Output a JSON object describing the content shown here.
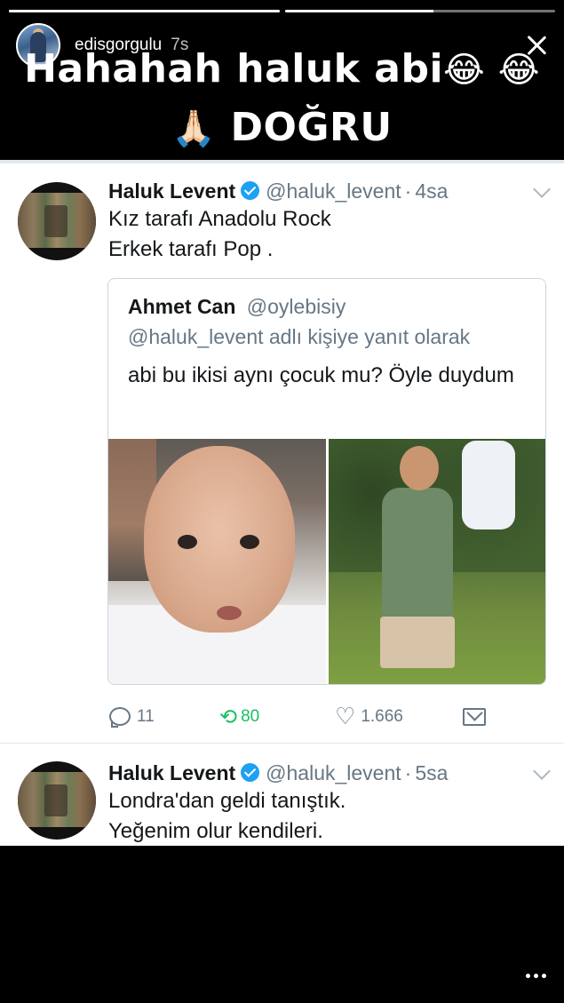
{
  "story": {
    "username": "edisgorgulu",
    "time": "7s",
    "caption_line1": "Hahahah haluk abi",
    "caption_line1_emoji": "😂 😂",
    "caption_line2_emoji": "🙏🏻",
    "caption_line2": "DOĞRU",
    "progress_segments": [
      1.0,
      0.55
    ]
  },
  "tweet1": {
    "name": "Haluk Levent",
    "handle": "@haluk_levent",
    "dot": "·",
    "time": "4sa",
    "text_line1": "Kız tarafı Anadolu Rock",
    "text_line2": "Erkek tarafı Pop .",
    "quote": {
      "name": "Ahmet Can",
      "handle": "@oylebisiy",
      "reply_context": "@haluk_levent adlı kişiye yanıt olarak",
      "text": "abi bu ikisi aynı çocuk mu? Öyle duydum"
    },
    "actions": {
      "replies": "11",
      "retweets": "80",
      "likes": "1.666"
    }
  },
  "tweet2": {
    "name": "Haluk Levent",
    "handle": "@haluk_levent",
    "dot": "·",
    "time": "5sa",
    "text_line1": "Londra'dan geldi tanıştık.",
    "text_line2": "Yeğenim olur kendileri."
  },
  "colors": {
    "verified": "#1da1f2",
    "retweet_active": "#17bf63",
    "secondary_text": "#657786"
  },
  "icons": [
    "close-icon",
    "verified-icon",
    "caret-down-icon",
    "reply-icon",
    "retweet-icon",
    "heart-icon",
    "mail-icon",
    "more-icon"
  ]
}
